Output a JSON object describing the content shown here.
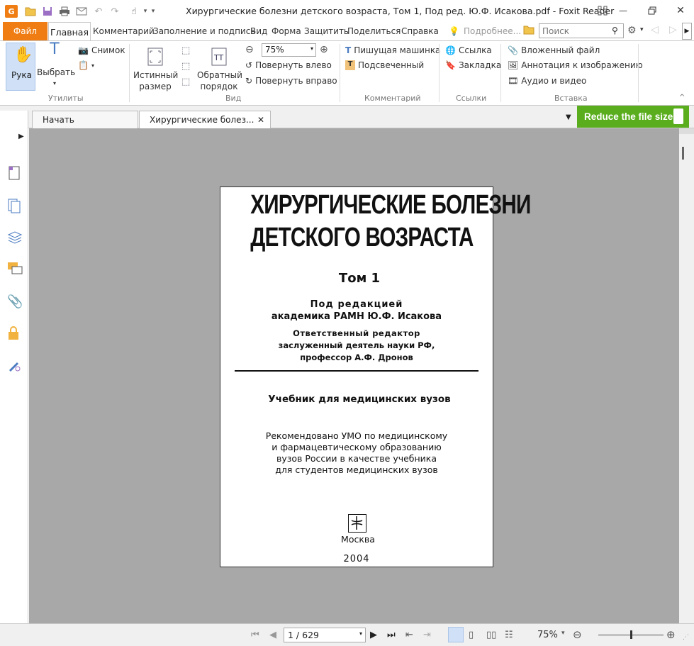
{
  "window": {
    "title": "Хирургические болезни детского возраста, Том 1, Под ред. Ю.Ф. Исакова.pdf - Foxit Reader"
  },
  "menu": {
    "file": "Файл",
    "home": "Главная",
    "items": [
      "Комментарий",
      "Заполнение и подпись",
      "Вид",
      "Форма",
      "Защитить",
      "Поделиться",
      "Справка"
    ],
    "tell_me": "Подробнее...",
    "search_placeholder": "Поиск"
  },
  "ribbon": {
    "hand": "Рука",
    "select": "Выбрать",
    "snapshot": "Снимок",
    "group_utils": "Утилиты",
    "actual_size": "Истинный размер",
    "actual_size_1": "Истинный",
    "actual_size_2": "размер",
    "reverse_1": "Обратный",
    "reverse_2": "порядок",
    "zoom_value": "75%",
    "rotate_left": "Повернуть влево",
    "rotate_right": "Повернуть вправо",
    "group_view": "Вид",
    "typewriter": "Пишущая машинка",
    "highlight": "Подсвеченный",
    "group_comment": "Комментарий",
    "link": "Ссылка",
    "bookmark": "Закладка",
    "group_links": "Ссылки",
    "attachment": "Вложенный файл",
    "image_annotation": "Аннотация к изображению",
    "audio_video": "Аудио и видео",
    "group_insert": "Вставка"
  },
  "tabs": [
    {
      "label": "Начать"
    },
    {
      "label": "Хирургические болез..."
    }
  ],
  "promo": {
    "label": "Reduce the file size",
    "color": "#5aae1e"
  },
  "document": {
    "title_line1": "ХИРУРГИЧЕСКИЕ БОЛЕЗНИ",
    "title_line2": "ДЕТСКОГО ВОЗРАСТА",
    "volume": "Том 1",
    "editor_line1": "Под редакцией",
    "editor_line2": "академика РАМН Ю.Ф. Исакова",
    "resp_line1": "Ответственный редактор",
    "resp_line2": "заслуженный деятель науки РФ,",
    "resp_line3": "профессор А.Ф. Дронов",
    "subtitle": "Учебник для медицинских вузов",
    "rec_line1": "Рекомендовано УМО по медицинскому",
    "rec_line2": "и фармацевтическому образованию",
    "rec_line3": "вузов России в качестве учебника",
    "rec_line4": "для студентов медицинских вузов",
    "city": "Москва",
    "year": "2004"
  },
  "status": {
    "page": "1 / 629",
    "zoom": "75%",
    "zoom_level": 0.5
  },
  "colors": {
    "accent": "#ef7d13",
    "promo": "#5aae1e",
    "doc_bg": "#a8a8a8"
  }
}
